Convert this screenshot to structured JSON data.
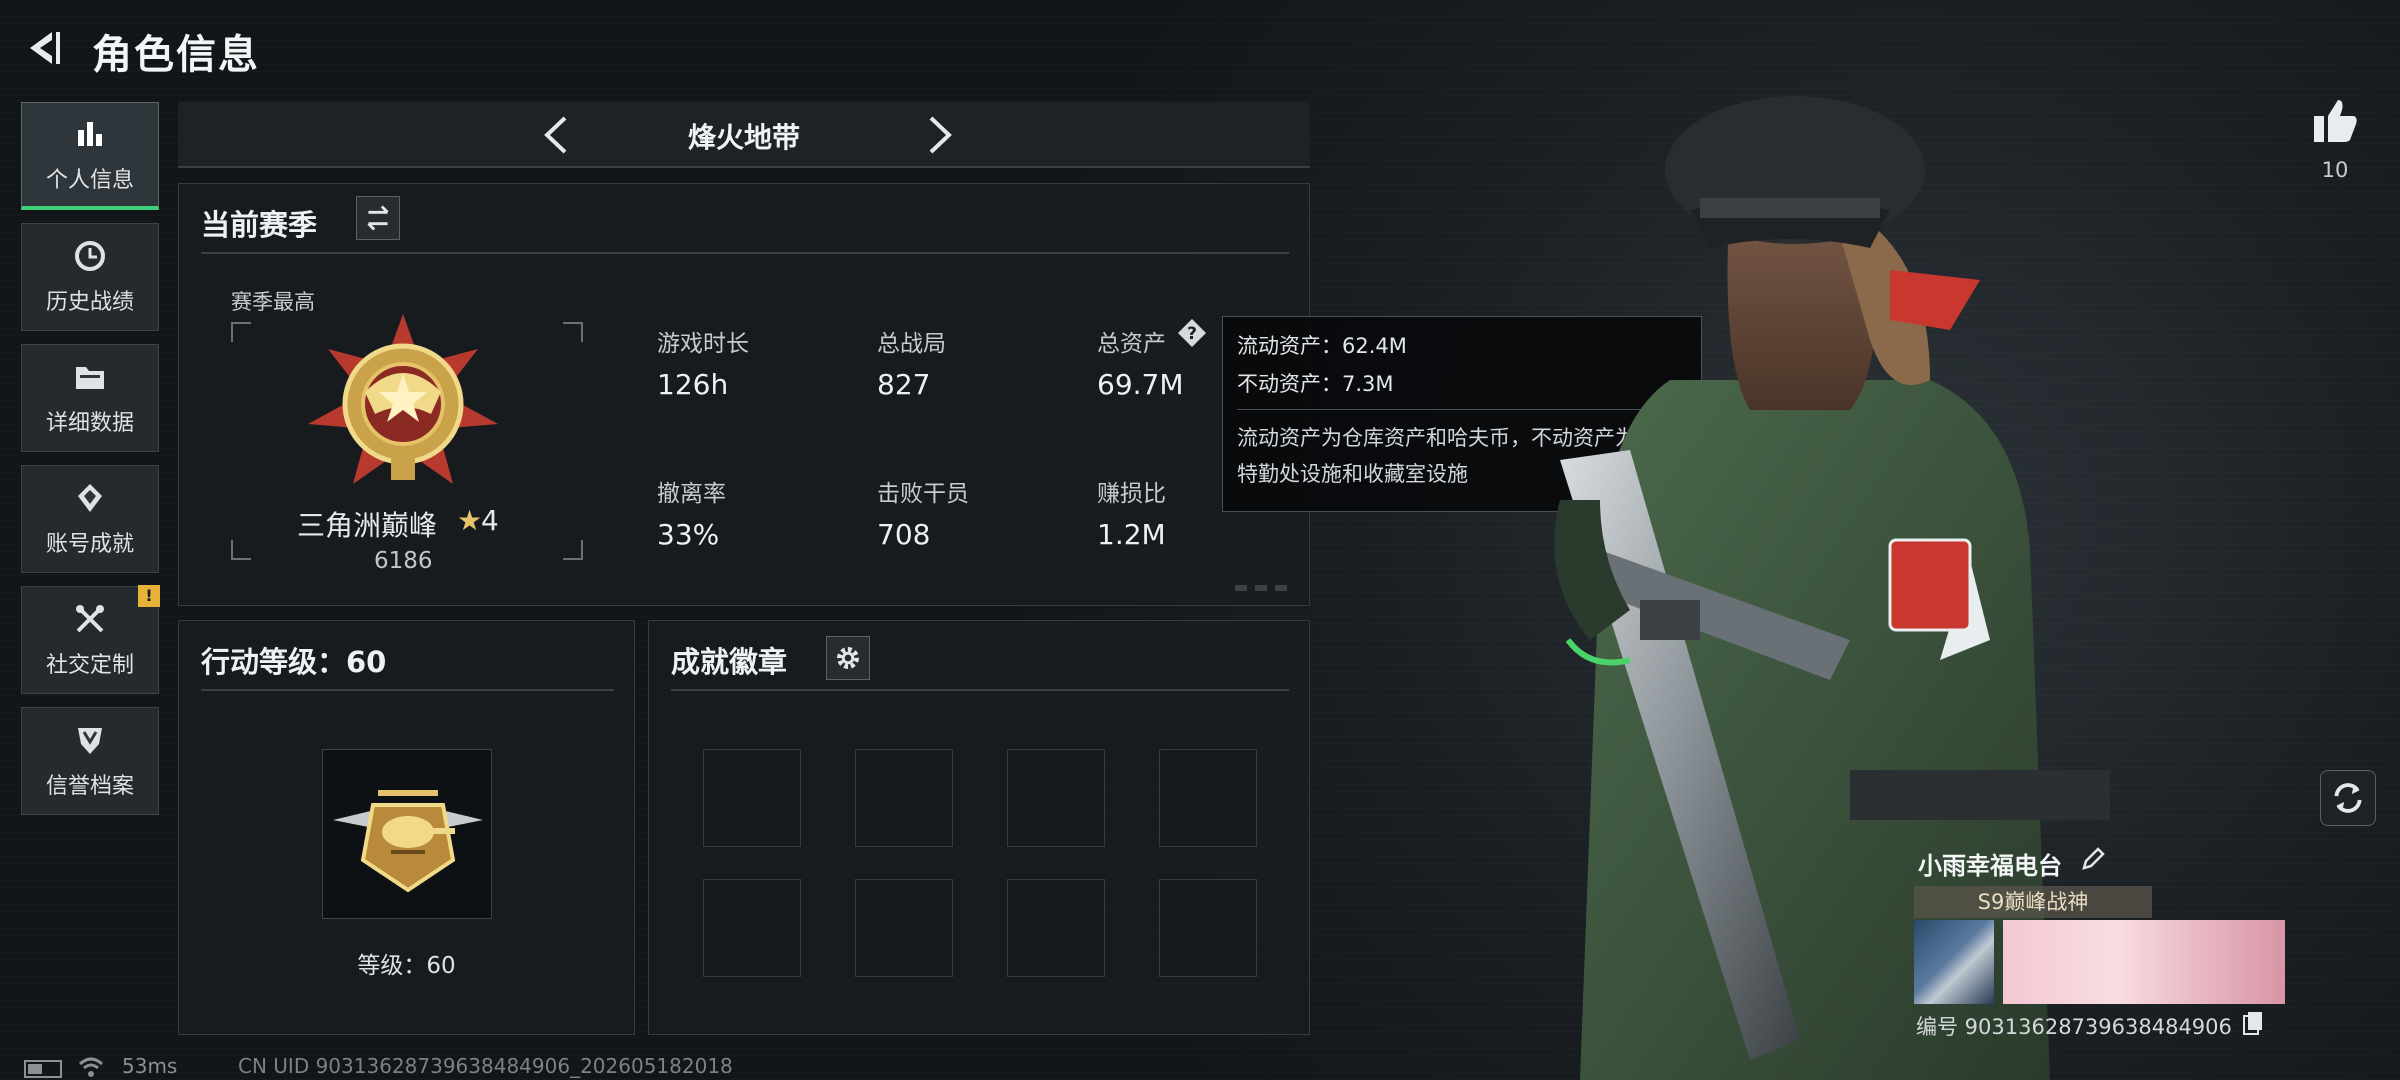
{
  "header": {
    "title": "角色信息",
    "back_icon": "back-arrow-icon"
  },
  "nav": {
    "items": [
      {
        "label": "个人信息",
        "icon": "bar-chart-icon",
        "active": true
      },
      {
        "label": "历史战绩",
        "icon": "clock-icon",
        "active": false
      },
      {
        "label": "详细数据",
        "icon": "folder-icon",
        "active": false
      },
      {
        "label": "账号成就",
        "icon": "achievement-icon",
        "active": false
      },
      {
        "label": "社交定制",
        "icon": "tools-icon",
        "active": false,
        "badge": "!"
      },
      {
        "label": "信誉档案",
        "icon": "shield-icon",
        "active": false
      }
    ]
  },
  "mode": {
    "name": "烽火地带"
  },
  "season": {
    "title": "当前赛季",
    "best_label": "赛季最高",
    "rank_name": "三角洲巅峰",
    "rank_star": "★",
    "rank_stars": "4",
    "rank_score": "6186",
    "stats": [
      {
        "key": "游戏时长",
        "value": "126h"
      },
      {
        "key": "总战局",
        "value": "827"
      },
      {
        "key": "总资产",
        "value": "69.7M"
      },
      {
        "key": "撤离率",
        "value": "33%"
      },
      {
        "key": "击败干员",
        "value": "708"
      },
      {
        "key": "赚损比",
        "value": "1.2M"
      }
    ]
  },
  "tooltip": {
    "liquid": "流动资产：62.4M",
    "fixed": "不动资产：7.3M",
    "desc_line1": "流动资产为仓库资产和哈夫币，不动资产为",
    "desc_line2": "特勤处设施和收藏室设施"
  },
  "action_level": {
    "title": "行动等级：60",
    "level_label": "等级：60"
  },
  "badges": {
    "title": "成就徽章",
    "slot_count": 8
  },
  "likes": {
    "count": "10"
  },
  "player_card": {
    "name": "小雨幸福电台",
    "title": "S9巅峰战神",
    "uid": "编号 9031362873963848490​6"
  },
  "status_bar": {
    "ping": "53ms",
    "uid_line": "CN UID 9031362873963848490​6_202605182018"
  },
  "colors": {
    "accent": "#3fd07a",
    "warning": "#e8b23a",
    "panel_bg": "#181c1f"
  }
}
